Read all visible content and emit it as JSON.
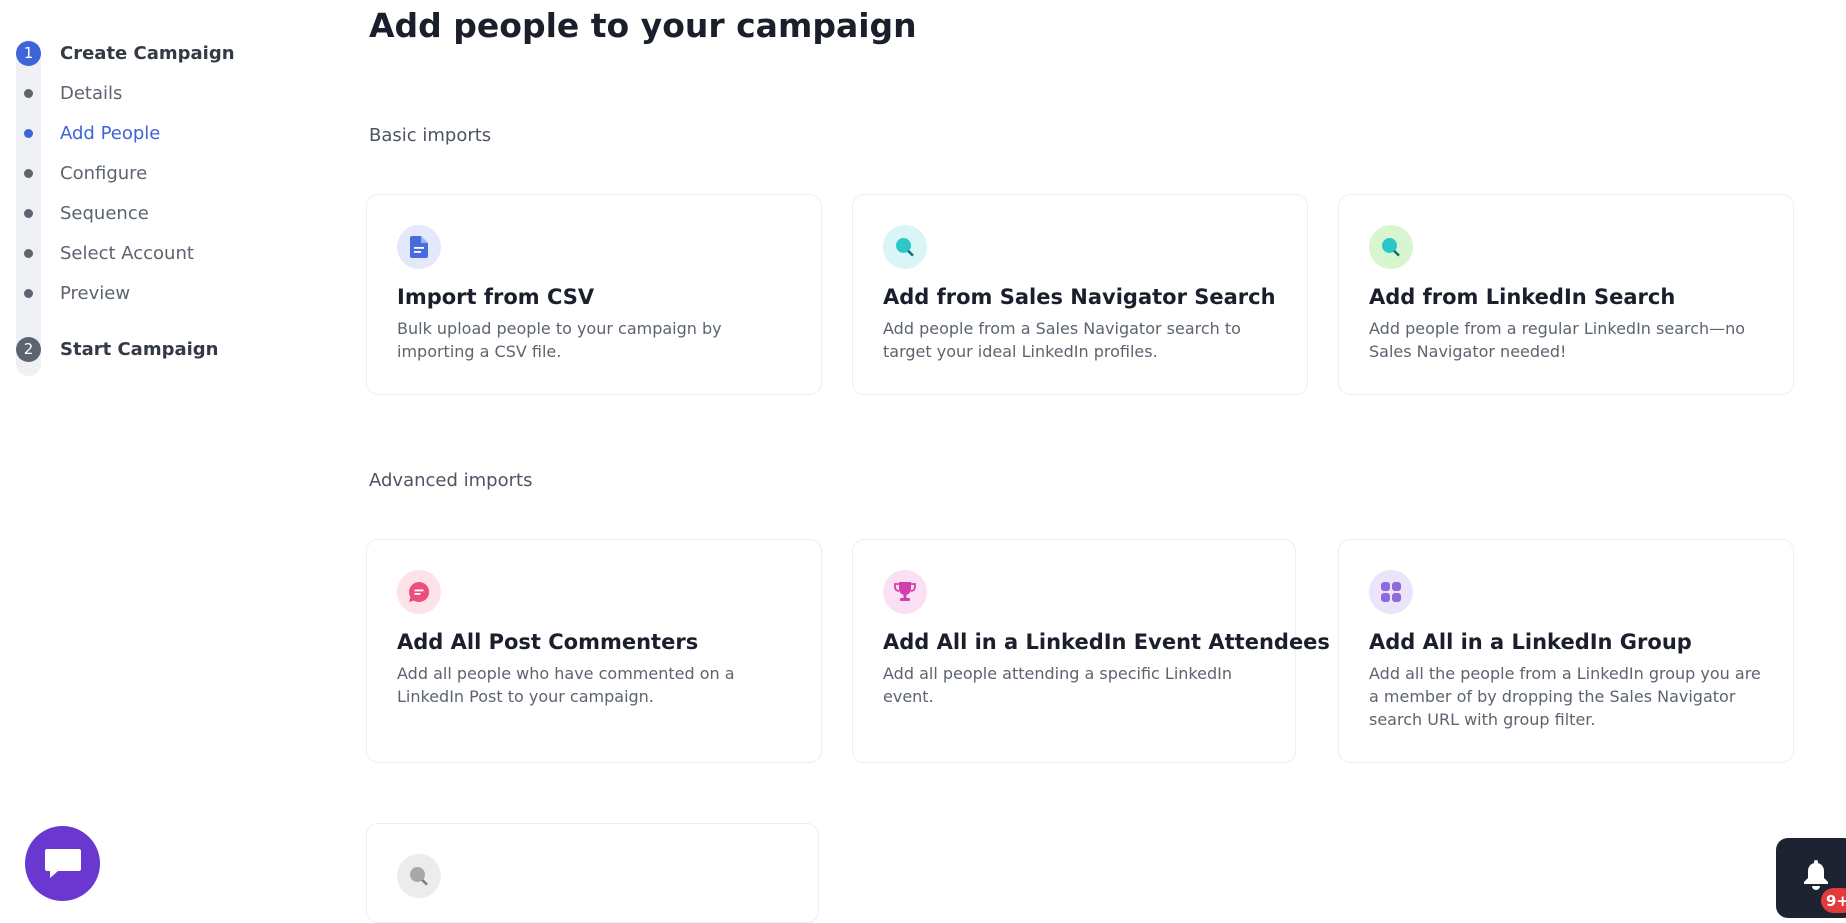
{
  "sidebar": {
    "steps": [
      {
        "number": "1",
        "title": "Create Campaign",
        "state": "active"
      },
      {
        "number": "2",
        "title": "Start Campaign",
        "state": "inactive"
      }
    ],
    "substeps": [
      {
        "label": "Details",
        "active": false
      },
      {
        "label": "Add People",
        "active": true
      },
      {
        "label": "Configure",
        "active": false
      },
      {
        "label": "Sequence",
        "active": false
      },
      {
        "label": "Select Account",
        "active": false
      },
      {
        "label": "Preview",
        "active": false
      }
    ]
  },
  "main": {
    "title": "Add people to your campaign",
    "basic": {
      "label": "Basic imports",
      "cards": [
        {
          "icon": "document-icon",
          "title": "Import from CSV",
          "description": "Bulk upload people to your campaign by importing a CSV file."
        },
        {
          "icon": "search-icon",
          "title": "Add from Sales Navigator Search",
          "description": "Add people from a Sales Navigator search to target your ideal LinkedIn profiles."
        },
        {
          "icon": "search-icon",
          "title": "Add from LinkedIn Search",
          "description": "Add people from a regular LinkedIn search—no Sales Navigator needed!"
        }
      ]
    },
    "advanced": {
      "label": "Advanced imports",
      "cards": [
        {
          "icon": "comment-icon",
          "title": "Add All Post Commenters",
          "description": "Add all people who have commented on a LinkedIn Post to your campaign."
        },
        {
          "icon": "trophy-icon",
          "title": "Add All in a LinkedIn Event Attendees",
          "description": "Add all people attending a specific LinkedIn event."
        },
        {
          "icon": "grid-icon",
          "title": "Add All in a LinkedIn Group",
          "description": "Add all the people from a LinkedIn group you are a member of by dropping the Sales Navigator search URL with group filter."
        }
      ]
    }
  },
  "widgets": {
    "chat_icon": "chat-icon",
    "notification_icon": "bell-icon",
    "notification_badge": "9+"
  },
  "colors": {
    "accent": "#3f63d8",
    "chat": "#6a37d0",
    "badge": "#e23b3b"
  }
}
